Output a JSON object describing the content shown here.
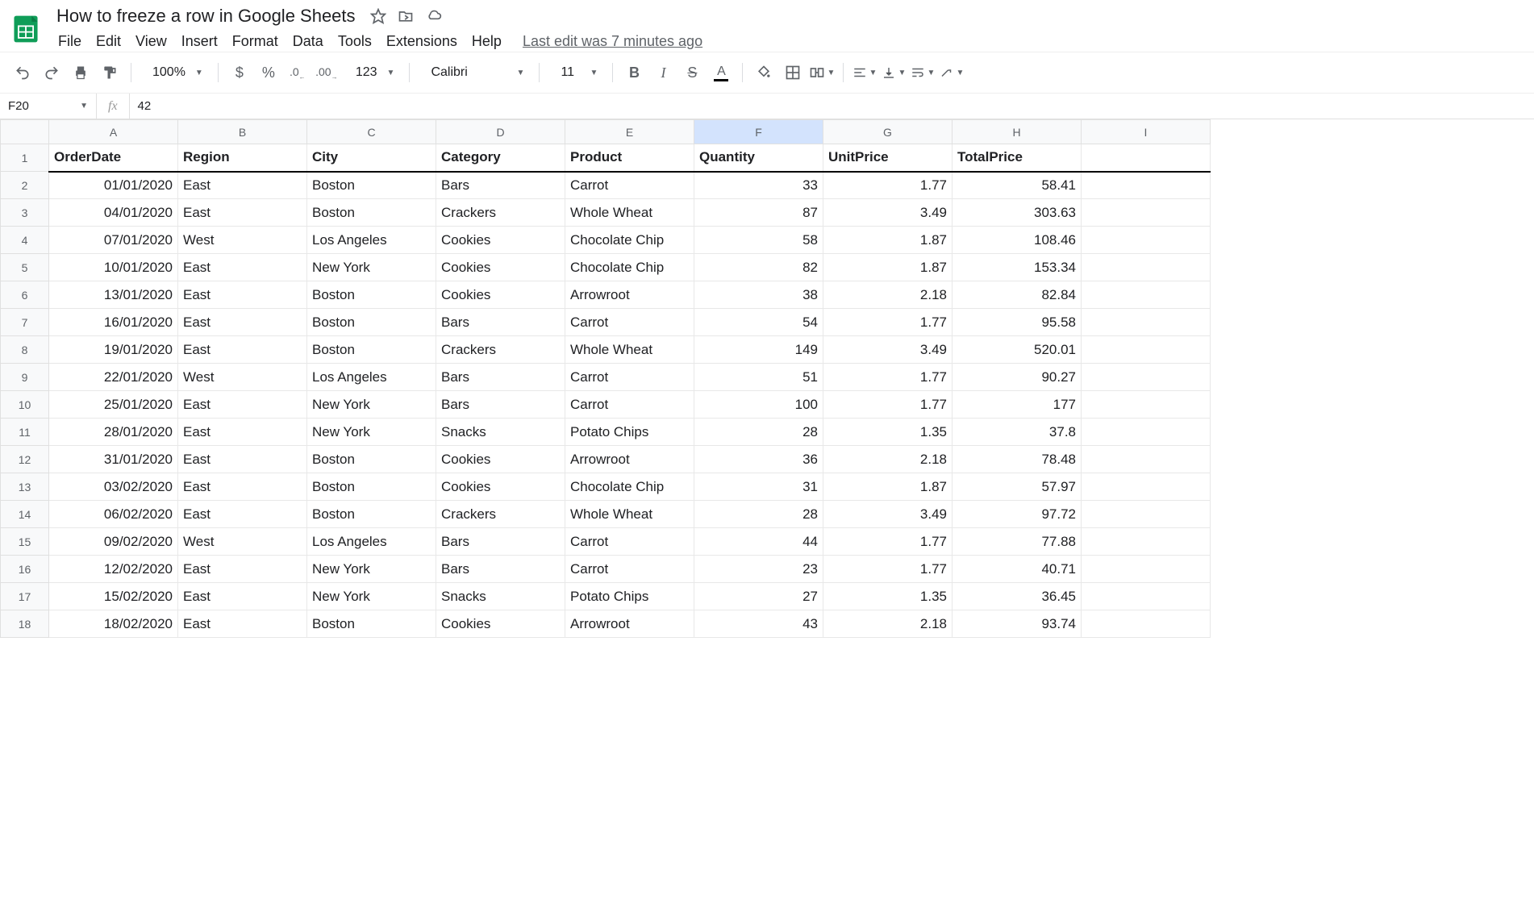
{
  "doc": {
    "title": "How to freeze a row in Google Sheets",
    "last_edit": "Last edit was 7 minutes ago"
  },
  "menu": [
    "File",
    "Edit",
    "View",
    "Insert",
    "Format",
    "Data",
    "Tools",
    "Extensions",
    "Help"
  ],
  "toolbar": {
    "zoom": "100%",
    "font": "Calibri",
    "font_size": "11",
    "more_formats": "123"
  },
  "formula_bar": {
    "cell_ref": "F20",
    "fx": "fx",
    "value": "42"
  },
  "columns": [
    "A",
    "B",
    "C",
    "D",
    "E",
    "F",
    "G",
    "H",
    "I"
  ],
  "selected_column": "F",
  "headers": [
    "OrderDate",
    "Region",
    "City",
    "Category",
    "Product",
    "Quantity",
    "UnitPrice",
    "TotalPrice"
  ],
  "rows": [
    [
      "01/01/2020",
      "East",
      "Boston",
      "Bars",
      "Carrot",
      "33",
      "1.77",
      "58.41"
    ],
    [
      "04/01/2020",
      "East",
      "Boston",
      "Crackers",
      "Whole Wheat",
      "87",
      "3.49",
      "303.63"
    ],
    [
      "07/01/2020",
      "West",
      "Los Angeles",
      "Cookies",
      "Chocolate Chip",
      "58",
      "1.87",
      "108.46"
    ],
    [
      "10/01/2020",
      "East",
      "New York",
      "Cookies",
      "Chocolate Chip",
      "82",
      "1.87",
      "153.34"
    ],
    [
      "13/01/2020",
      "East",
      "Boston",
      "Cookies",
      "Arrowroot",
      "38",
      "2.18",
      "82.84"
    ],
    [
      "16/01/2020",
      "East",
      "Boston",
      "Bars",
      "Carrot",
      "54",
      "1.77",
      "95.58"
    ],
    [
      "19/01/2020",
      "East",
      "Boston",
      "Crackers",
      "Whole Wheat",
      "149",
      "3.49",
      "520.01"
    ],
    [
      "22/01/2020",
      "West",
      "Los Angeles",
      "Bars",
      "Carrot",
      "51",
      "1.77",
      "90.27"
    ],
    [
      "25/01/2020",
      "East",
      "New York",
      "Bars",
      "Carrot",
      "100",
      "1.77",
      "177"
    ],
    [
      "28/01/2020",
      "East",
      "New York",
      "Snacks",
      "Potato Chips",
      "28",
      "1.35",
      "37.8"
    ],
    [
      "31/01/2020",
      "East",
      "Boston",
      "Cookies",
      "Arrowroot",
      "36",
      "2.18",
      "78.48"
    ],
    [
      "03/02/2020",
      "East",
      "Boston",
      "Cookies",
      "Chocolate Chip",
      "31",
      "1.87",
      "57.97"
    ],
    [
      "06/02/2020",
      "East",
      "Boston",
      "Crackers",
      "Whole Wheat",
      "28",
      "3.49",
      "97.72"
    ],
    [
      "09/02/2020",
      "West",
      "Los Angeles",
      "Bars",
      "Carrot",
      "44",
      "1.77",
      "77.88"
    ],
    [
      "12/02/2020",
      "East",
      "New York",
      "Bars",
      "Carrot",
      "23",
      "1.77",
      "40.71"
    ],
    [
      "15/02/2020",
      "East",
      "New York",
      "Snacks",
      "Potato Chips",
      "27",
      "1.35",
      "36.45"
    ],
    [
      "18/02/2020",
      "East",
      "Boston",
      "Cookies",
      "Arrowroot",
      "43",
      "2.18",
      "93.74"
    ]
  ]
}
